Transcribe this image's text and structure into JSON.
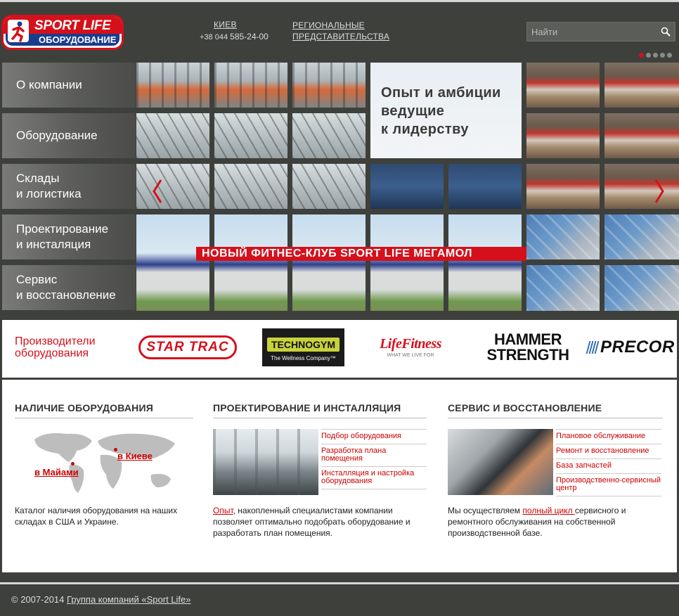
{
  "header": {
    "logo": {
      "line1": "SPORT LIFE",
      "line2": "ОБОРУДОВАНИЕ"
    },
    "city": "КИЕВ",
    "phone_prefix": "+38 044",
    "phone_number": "585-24-00",
    "regional_line1": "РЕГИОНАЛЬНЫЕ",
    "regional_line2": "ПРЕДСТАВИТЕЛЬСТВА",
    "search_placeholder": "Найти"
  },
  "slider": {
    "dots_count": 5,
    "active_dot": 1,
    "hero_line1": "Опыт и амбиции",
    "hero_line2": "ведущие",
    "hero_line3": "к лидерству",
    "building_banner": "НОВЫЙ ФИТНЕС-КЛУБ SPORT LIFE МЕГАМОЛ"
  },
  "nav": {
    "items": [
      {
        "line1": "О компании",
        "line2": ""
      },
      {
        "line1": "Оборудование",
        "line2": ""
      },
      {
        "line1": "Склады",
        "line2": "и логистика"
      },
      {
        "line1": "Проектирование",
        "line2": "и инсталяция"
      },
      {
        "line1": "Сервис",
        "line2": "и восстановление"
      }
    ]
  },
  "brands": {
    "title_line1": "Производители",
    "title_line2": "оборудования",
    "startrac": "STAR TRAC",
    "technogym": "TECHNOGYM",
    "technogym_sub": "The Wellness Company™",
    "lifefitness": "LifeFitness",
    "lifefitness_sub": "WHAT WE LIVE FOR",
    "hammer_line1": "HAMMER",
    "hammer_line2": "STRENGTH",
    "precor": "PRECOR"
  },
  "sections": {
    "availability": {
      "title": "НАЛИЧИЕ ОБОРУДОВАНИЯ",
      "link_kiev": "в Киеве",
      "link_miami": "в Майами",
      "desc": "Каталог наличия оборудования на наших складах в США и Украине."
    },
    "design": {
      "title": "ПРОЕКТИРОВАНИЕ И ИНСТАЛЛЯЦИЯ",
      "links": [
        "Подбор оборудования",
        "Разработка плана помещения",
        "Инсталляция и настройка оборудования"
      ],
      "desc_link": "Опыт",
      "desc_rest": ", накопленный специалистами компании позволяет оптимально подобрать оборудование и разработать план помещения."
    },
    "service": {
      "title": "СЕРВИС И ВОССТАНОВЛЕНИЕ",
      "links": [
        "Плановое обслуживание",
        "Ремонт и восстановление",
        "База запчастей",
        "Производственно-сервисный центр"
      ],
      "desc_pre": "Мы осуществляем ",
      "desc_link": "полный цикл ",
      "desc_rest": "сервисного и ремонтного обслуживания на собственной производственной базе."
    }
  },
  "footer": {
    "copyright": "© 2007-2014",
    "company_link": "Группа компаний «Sport Life»"
  },
  "colors": {
    "accent": "#d5101b",
    "background": "#3e403c",
    "nav": "#5b5c59"
  }
}
